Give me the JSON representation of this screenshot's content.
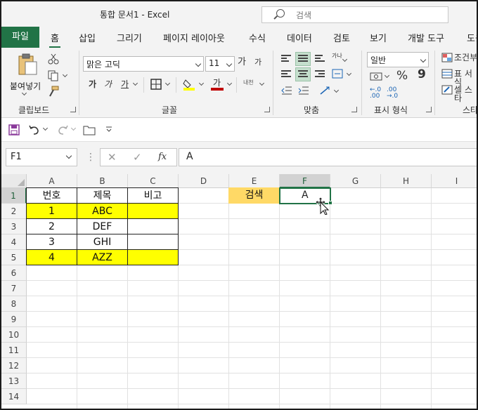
{
  "titlebar": {
    "title": "통합 문서1  -  Excel",
    "search_placeholder": "검색"
  },
  "tabs": [
    "파일",
    "홈",
    "삽입",
    "그리기",
    "페이지 레이아웃",
    "수식",
    "데이터",
    "검토",
    "보기",
    "개발 도구",
    "도움"
  ],
  "ribbon": {
    "clipboard": {
      "paste_label": "붙여넣기",
      "group_label": "클립보드"
    },
    "font": {
      "font_name": "맑은 고딕",
      "font_size": "11",
      "group_label": "글꼴",
      "bold": "가",
      "italic": "가",
      "underline": "가",
      "grow": "가",
      "shrink": "가",
      "phonetic": "내천"
    },
    "align": {
      "group_label": "맞춤",
      "wrap": "가나"
    },
    "number": {
      "format": "일반",
      "group_label": "표시 형식",
      "percent": "%",
      "comma": "9"
    },
    "styles": {
      "cond": "조건부",
      "table": "표 서식",
      "cell": "셀 스타",
      "group_label": "스타"
    },
    "colors": {
      "accent": "#217346",
      "font_color": "#c00000",
      "highlight": "#ffff00"
    }
  },
  "formula_bar": {
    "name_box": "F1",
    "formula": "A",
    "fx": "fx"
  },
  "sheet": {
    "columns": [
      "A",
      "B",
      "C",
      "D",
      "E",
      "F",
      "G",
      "H",
      "I"
    ],
    "rows": [
      "1",
      "2",
      "3",
      "4",
      "5",
      "6",
      "7",
      "8",
      "9",
      "10",
      "11",
      "12",
      "13",
      "14"
    ],
    "selected_column": "F",
    "selected_row": "1",
    "cells": {
      "A1": "번호",
      "B1": "제목",
      "C1": "비고",
      "A2": "1",
      "B2": "ABC",
      "A3": "2",
      "B3": "DEF",
      "A4": "3",
      "B4": "GHI",
      "A5": "4",
      "B5": "AZZ",
      "E1": "검색",
      "F1": "A"
    },
    "highlight_color": "#ffff00",
    "search_label_color": "#ffd966"
  }
}
